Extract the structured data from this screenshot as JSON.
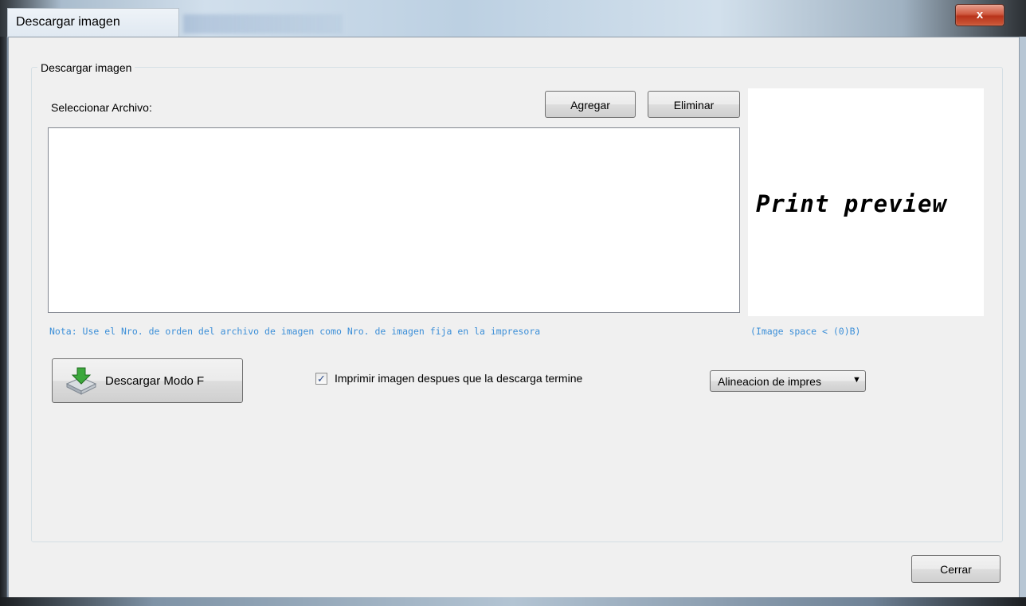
{
  "window": {
    "title": "Descargar imagen",
    "close_symbol": "x"
  },
  "group": {
    "title": "Descargar imagen"
  },
  "file_select": {
    "label": "Seleccionar Archivo:",
    "add_label": "Agregar",
    "remove_label": "Eliminar",
    "files": []
  },
  "preview": {
    "text": "Print preview"
  },
  "notes": {
    "order_note": "Nota: Use el Nro. de orden del archivo de imagen como Nro. de imagen fija en la impresora",
    "space_note": "(Image space < (0)B)"
  },
  "actions": {
    "download_label": "Descargar Modo F",
    "download_icon": "download-drive-icon",
    "print_after_label": "Imprimir imagen despues que la descarga termine",
    "print_after_checked": true,
    "check_mark": "✓",
    "alignment_value": "Alineacion de impres",
    "alignment_arrow": "▼"
  },
  "footer": {
    "close_label": "Cerrar"
  },
  "colors": {
    "note_text": "#3c8fd8",
    "close_button": "#c8432a"
  }
}
